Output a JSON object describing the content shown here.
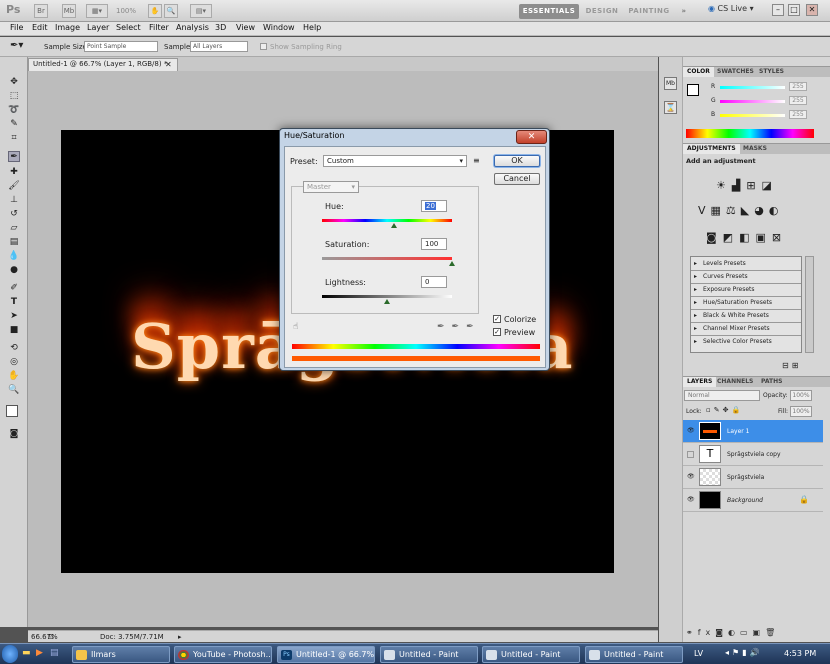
{
  "appbar": {
    "logo": "Ps",
    "zoom": "100%",
    "workspaces": [
      "ESSENTIALS",
      "DESIGN",
      "PAINTING"
    ],
    "more": "»",
    "cslive": "CS Live",
    "win_min": "–",
    "win_max": "□",
    "win_close": "✕"
  },
  "menu": [
    "File",
    "Edit",
    "Image",
    "Layer",
    "Select",
    "Filter",
    "Analysis",
    "3D",
    "View",
    "Window",
    "Help"
  ],
  "options": {
    "sample_size_label": "Sample Size:",
    "sample_size_value": "Point Sample",
    "sample_label": "Sample:",
    "sample_value": "All Layers",
    "show_ring": "Show Sampling Ring"
  },
  "document": {
    "tab_title": "Untitled-1 @ 66.7% (Layer 1, RGB/8) *",
    "canvas_text": "Sprāgstviela",
    "zoom_status": "66.67%",
    "doc_size": "Doc: 3.75M/7.71M"
  },
  "dialog": {
    "title": "Hue/Saturation",
    "close": "✕",
    "preset_label": "Preset:",
    "preset_value": "Custom",
    "ok": "OK",
    "cancel": "Cancel",
    "channel": "Master",
    "hue_label": "Hue:",
    "hue_value": "20",
    "hue_fraction": 0.556,
    "saturation_label": "Saturation:",
    "saturation_value": "100",
    "saturation_fraction": 1.0,
    "lightness_label": "Lightness:",
    "lightness_value": "0",
    "lightness_fraction": 0.5,
    "colorize": "Colorize",
    "preview": "Preview"
  },
  "color_panel": {
    "tabs": [
      "COLOR",
      "SWATCHES",
      "STYLES"
    ],
    "r_label": "R",
    "g_label": "G",
    "b_label": "B",
    "r_value": "255",
    "g_value": "255",
    "b_value": "255"
  },
  "adjustments_panel": {
    "tabs": [
      "ADJUSTMENTS",
      "MASKS"
    ],
    "heading": "Add an adjustment",
    "presets": [
      "Levels Presets",
      "Curves Presets",
      "Exposure Presets",
      "Hue/Saturation Presets",
      "Black & White Presets",
      "Channel Mixer Presets",
      "Selective Color Presets"
    ]
  },
  "layers_panel": {
    "tabs": [
      "LAYERS",
      "CHANNELS",
      "PATHS"
    ],
    "blend_mode": "Normal",
    "opacity_label": "Opacity:",
    "opacity_value": "100%",
    "lock_label": "Lock:",
    "fill_label": "Fill:",
    "fill_value": "100%",
    "layers": [
      {
        "name": "Layer 1",
        "selected": true,
        "visible": true
      },
      {
        "name": "Sprāgstviela copy",
        "selected": false,
        "visible": false
      },
      {
        "name": "Sprāgstviela",
        "selected": false,
        "visible": true
      },
      {
        "name": "Background",
        "selected": false,
        "visible": true
      }
    ]
  },
  "taskbar": {
    "items": [
      "Ilmars",
      "YouTube - Photosh...",
      "Untitled-1 @ 66.7% (...",
      "Untitled - Paint",
      "Untitled - Paint",
      "Untitled - Paint"
    ],
    "lang": "LV",
    "time": "4:53 PM"
  },
  "colors": {
    "accent_orange": "#ff5a00",
    "selection_blue": "#3d8ee8"
  }
}
